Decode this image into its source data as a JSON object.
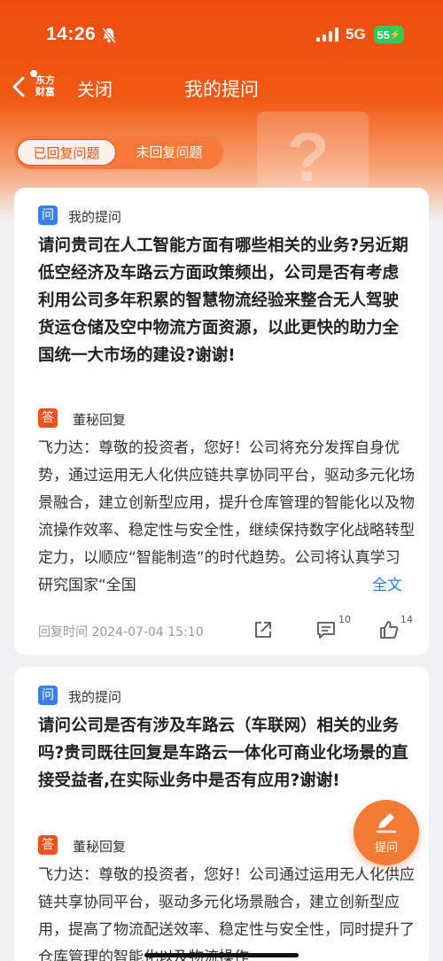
{
  "status_bar": {
    "time": "14:26",
    "network": "5G",
    "battery": "55"
  },
  "nav": {
    "logo_line1": "东方",
    "logo_line2": "财富",
    "close_label": "关闭",
    "title": "我的提问"
  },
  "tabs": [
    {
      "label": "已回复问题",
      "active": true
    },
    {
      "label": "未回复问题",
      "active": false
    }
  ],
  "cards": [
    {
      "question_badge": "问",
      "question_label": "我的提问",
      "question_text": "请问贵司在人工智能方面有哪些相关的业务?另近期低空经济及车路云方面政策频出，公司是否有考虑利用公司多年积累的智慧物流经验来整合无人驾驶货运仓储及空中物流方面资源，以此更快的助力全国统一大市场的建设?谢谢!",
      "answer_badge": "答",
      "answer_label": "董秘回复",
      "answer_text": "飞力达：尊敬的投资者，您好！公司将充分发挥自身优势，通过运用无人化供应链共享协同平台，驱动多元化场景融合，建立创新型应用，提升仓库管理的智能化以及物流操作效率、稳定性与安全性，继续保持数字化战略转型定力，以顺应“智能制造”的时代趋势。公司将认真学习研究国家“全国",
      "full_text_link": "全文",
      "reply_time": "回复时间 2024-07-04 15:10",
      "comment_count": "10",
      "like_count": "14"
    },
    {
      "question_badge": "问",
      "question_label": "我的提问",
      "question_text": "请问公司是否有涉及车路云（车联网）相关的业务吗?贵司既往回复是车路云一体化可商业化场景的直接受益者,在实际业务中是否有应用?谢谢!",
      "answer_badge": "答",
      "answer_label": "董秘回复",
      "answer_text": "飞力达：尊敬的投资者，您好！公司通过运用无人化供应链共享协同平台，驱动多元化场景融合，建立创新型应用，提高了物流配送效率、稳定性与安全性，同时提升了仓库管理的智能化以及物流操作"
    }
  ],
  "fab": {
    "label": "提问"
  },
  "colors": {
    "brand_orange": "#ef4d0f",
    "question_blue": "#3d7fe0",
    "answer_orange": "#f0501a",
    "link_blue": "#3578e5"
  }
}
